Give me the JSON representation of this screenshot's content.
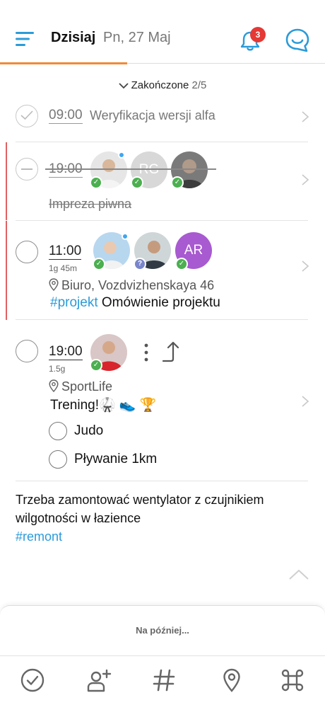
{
  "header": {
    "title": "Dzisiaj",
    "date": "Pn, 27 Maj",
    "notification_count": "3",
    "accent_color": "#f08a3a",
    "icon_color": "#2b9bd9"
  },
  "completed_toggle": {
    "label": "Zakończone",
    "count": "2/5"
  },
  "tasks": [
    {
      "time": "09:00",
      "title": "Weryfikacja wersji alfa",
      "state": "completed"
    },
    {
      "time": "19:00",
      "title": "Impreza piwna",
      "state": "cancelled",
      "participants": [
        {
          "initials": ""
        },
        {
          "initials": "RG"
        },
        {
          "initials": ""
        }
      ]
    },
    {
      "time": "11:00",
      "duration": "1g 45m",
      "location": "Biuro, Vozdvizhenskaya 46",
      "tag": "#projekt",
      "title": "Omówienie projektu",
      "participants": [
        {
          "initials": ""
        },
        {
          "initials": ""
        },
        {
          "initials": "AR"
        }
      ]
    },
    {
      "time": "19:00",
      "duration": "1.5g",
      "location": "SportLife",
      "title": "Trening!🥋 👟 🏆",
      "subtasks": [
        {
          "label": "Judo"
        },
        {
          "label": "Pływanie 1km"
        }
      ]
    }
  ],
  "note": {
    "text": "Trzeba zamontować wentylator z czujnikiem wilgotności w łazience",
    "tag": "#remont"
  },
  "later_panel": {
    "label": "Na później..."
  },
  "bottom_bar": [
    "check-icon",
    "add-person-icon",
    "hashtag-icon",
    "location-pin-icon",
    "command-icon"
  ]
}
